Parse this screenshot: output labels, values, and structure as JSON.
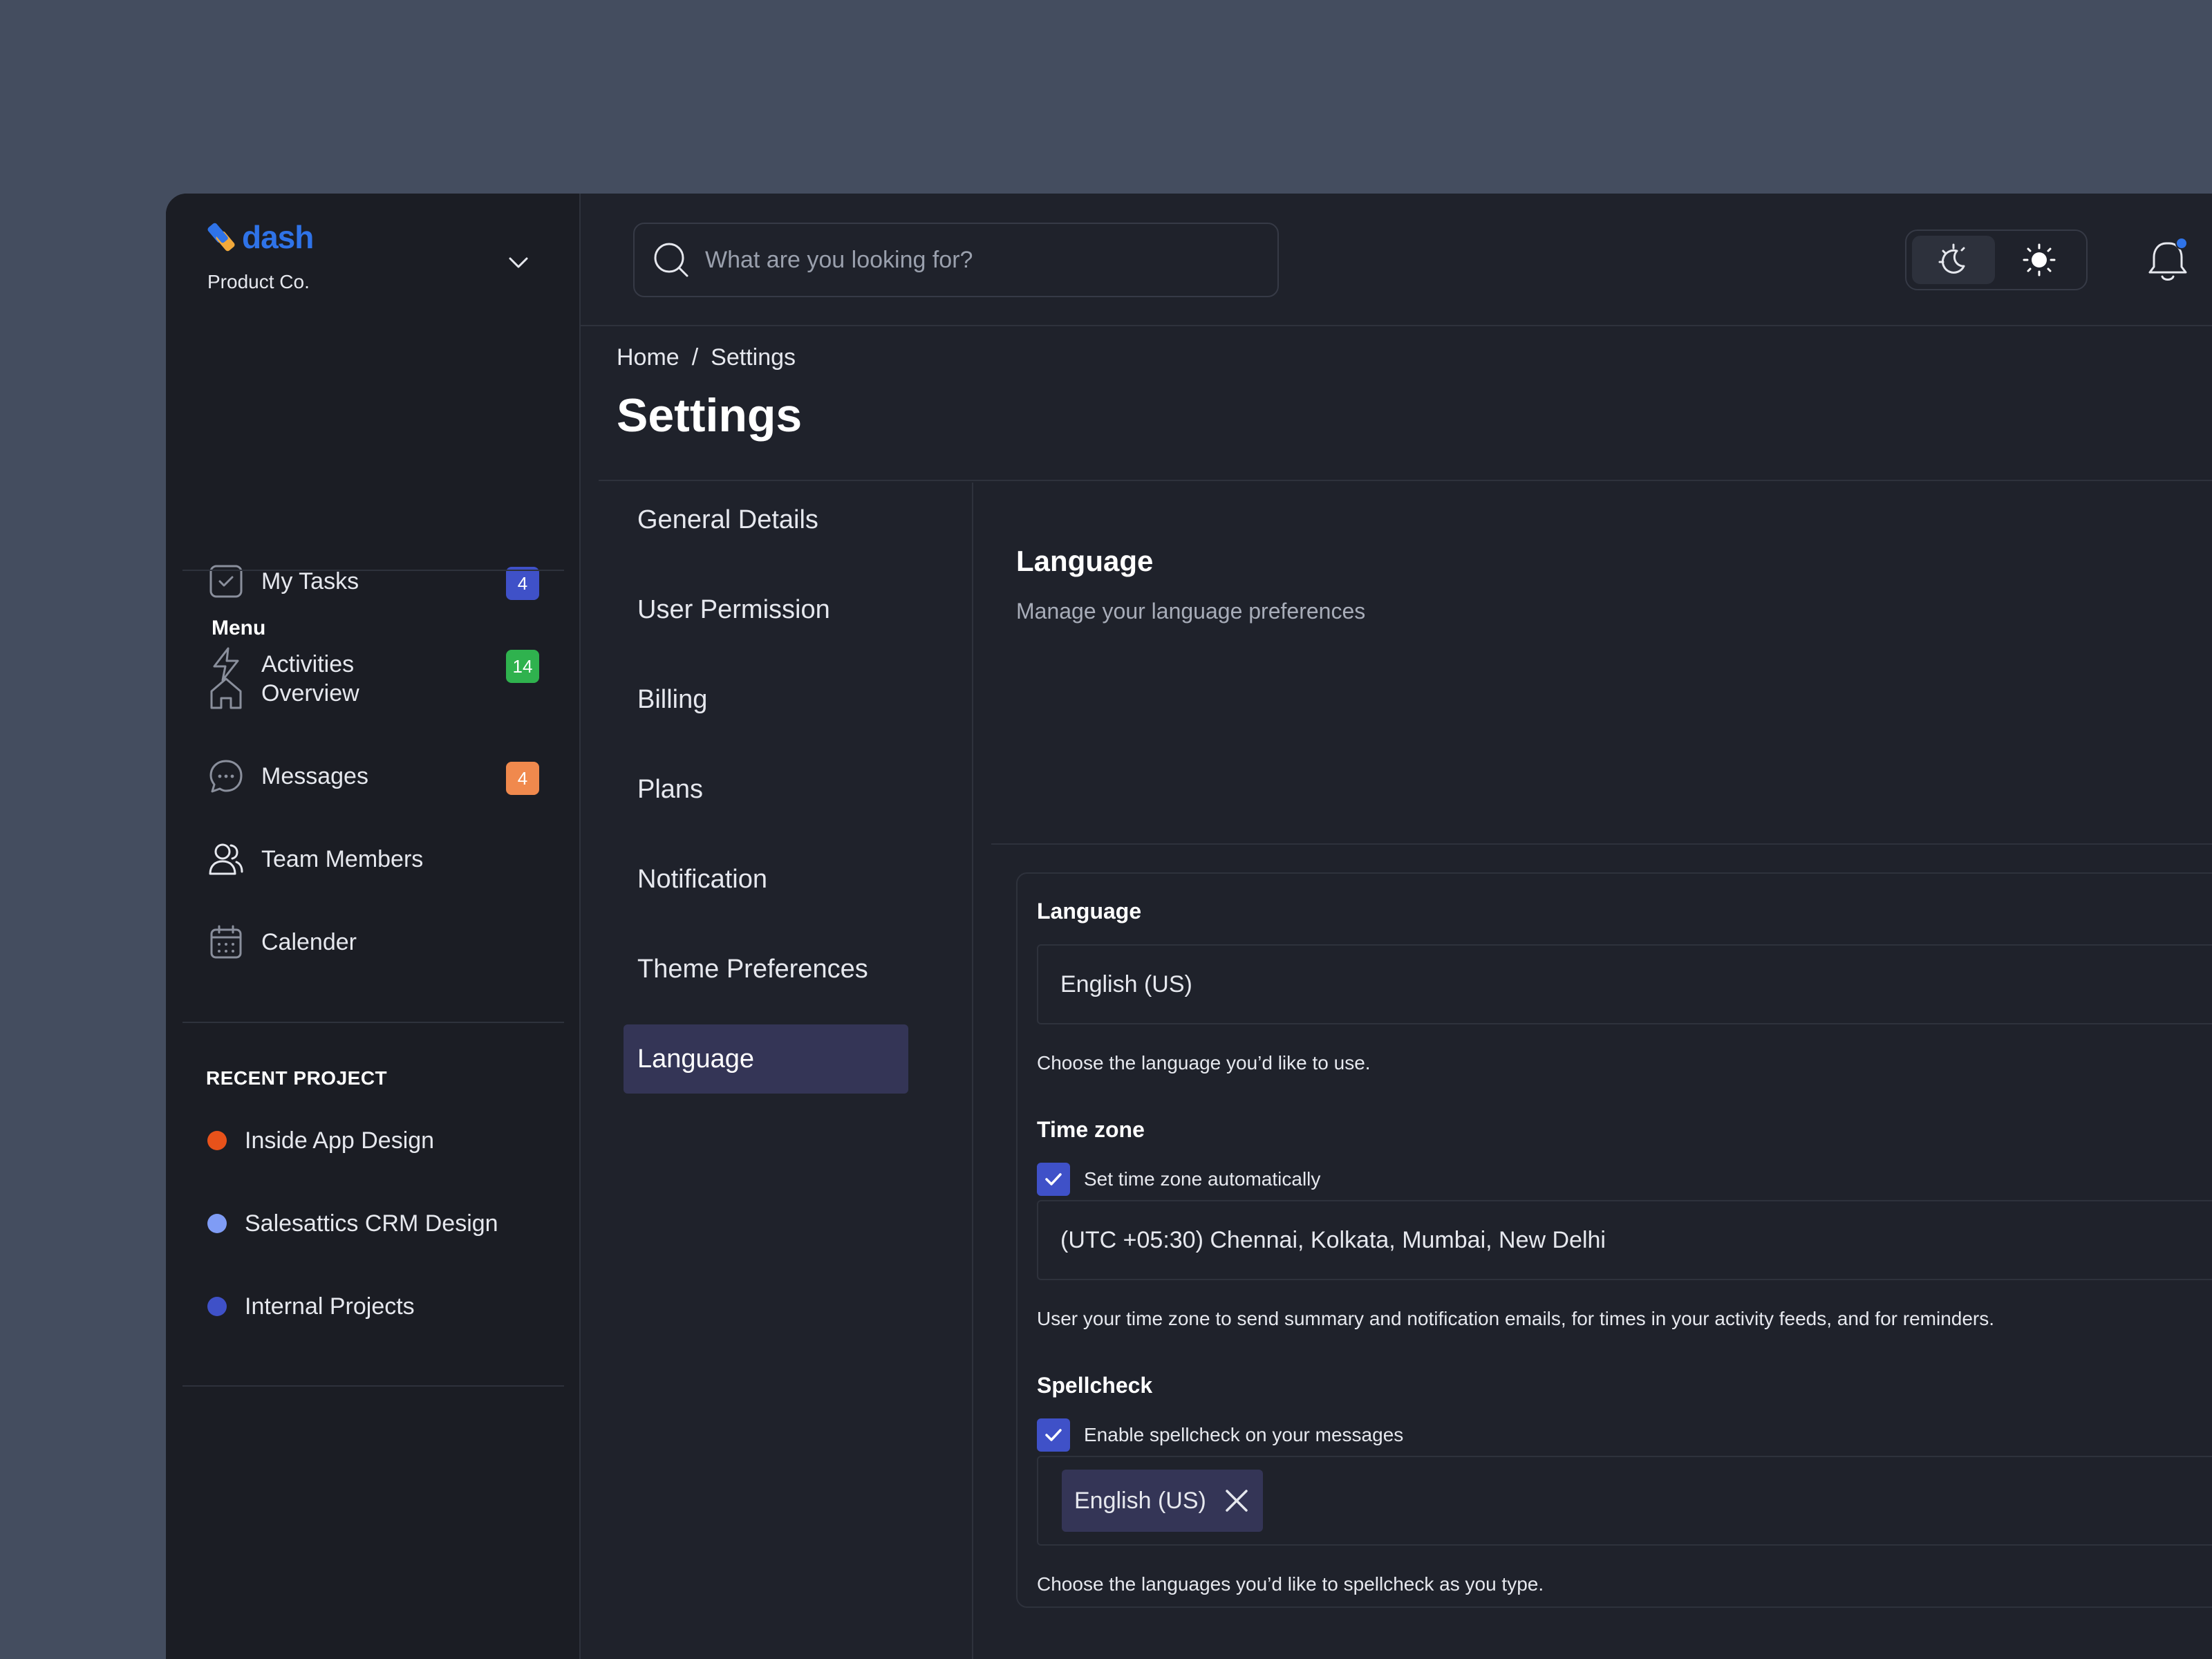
{
  "brand": {
    "name": "dash",
    "org": "Product Co."
  },
  "sidebar": {
    "top_items": [
      {
        "label": "My Tasks",
        "badge": "4",
        "badge_color": "#3f51c8"
      },
      {
        "label": "Activities",
        "badge": "14",
        "badge_color": "#2fb24e"
      }
    ],
    "menu_title": "Menu",
    "menu_items": [
      {
        "label": "Overview"
      },
      {
        "label": "Messages",
        "badge": "4",
        "badge_color": "#f0894d"
      },
      {
        "label": "Team Members"
      },
      {
        "label": "Calender"
      }
    ],
    "recent_title": "RECENT PROJECT",
    "projects": [
      {
        "label": "Inside App Design",
        "color": "#e8521a"
      },
      {
        "label": "Salesattics CRM Design",
        "color": "#7f9cf5"
      },
      {
        "label": "Internal Projects",
        "color": "#3f51c8"
      }
    ]
  },
  "topbar": {
    "search_placeholder": "What are you looking for?",
    "theme": "dark",
    "notification_dot_color": "#2f73e8"
  },
  "header": {
    "breadcrumb": [
      "Home",
      "/",
      "Settings"
    ],
    "title": "Settings"
  },
  "settings_nav": {
    "items": [
      "General Details",
      "User Permission",
      "Billing",
      "Plans",
      "Notification",
      "Theme Preferences",
      "Language"
    ],
    "active": "Language"
  },
  "content": {
    "title": "Language",
    "subtitle": "Manage your language preferences",
    "language": {
      "label": "Language",
      "value": "English (US)",
      "help": "Choose the language you’d like to use."
    },
    "timezone": {
      "label": "Time zone",
      "auto_label": "Set time zone automatically",
      "auto_checked": true,
      "value": "(UTC +05:30) Chennai, Kolkata, Mumbai, New Delhi",
      "help": "User your time zone to send summary and notification emails, for times in your activity feeds, and  for reminders."
    },
    "spellcheck": {
      "label": "Spellcheck",
      "enable_label": "Enable spellcheck on your messages",
      "enabled": true,
      "chip": "English (US)",
      "help": "Choose the languages you’d like to spellcheck as you type."
    }
  },
  "colors": {
    "accent": "#3f51c8",
    "brand": "#2f73e8",
    "background": "#1f222b",
    "sidebar": "#1b1d24"
  }
}
